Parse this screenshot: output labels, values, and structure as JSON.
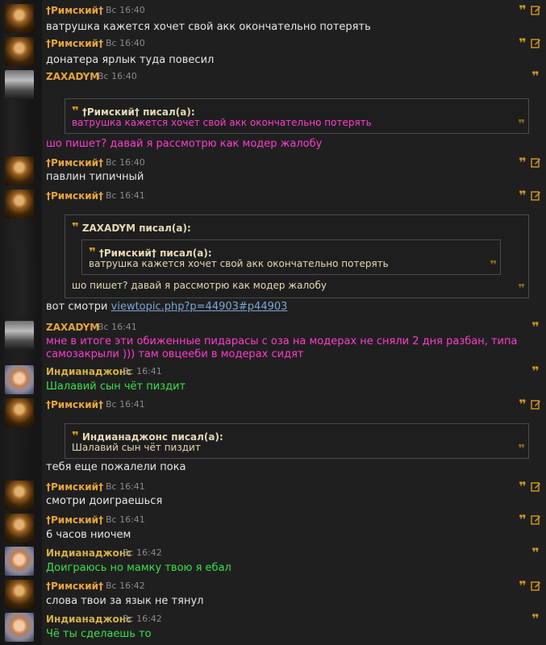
{
  "users": {
    "rimsky": "†Римский†",
    "zaxa": "ZAXADYM",
    "indy": "Индианаджонс"
  },
  "messages": [
    {
      "author": "†Римский†",
      "time": "Вс 16:40",
      "text": "ватрушка кажется хочет свой акк окончательно потерять"
    },
    {
      "author": "†Римский†",
      "time": "Вс 16:40",
      "text": "донатера ярлык туда повесил"
    },
    {
      "author": "ZAXADYM",
      "time": "Вс 16:40",
      "quote_header": "†Римский† писал(а):",
      "quote_text": "ватрушка кажется хочет свой акк окончательно потерять",
      "text": "шо пишет? давай я рассмотрю как модер жалобу"
    },
    {
      "author": "†Римский†",
      "time": "Вс 16:40",
      "text": "павлин типичный"
    },
    {
      "author": "†Римский†",
      "time": "Вс 16:41",
      "quote_header": "ZAXADYM писал(а):",
      "inner_quote_header": "†Римский† писал(а):",
      "inner_quote_text": "ватрушка кажется хочет свой акк окончательно потерять",
      "quote_text": "шо пишет? давай я рассмотрю как модер жалобу",
      "text": "вот смотри ",
      "link": "viewtopic.php?p=44903#p44903"
    },
    {
      "author": "ZAXADYM",
      "time": "Вс 16:41",
      "text_line1": "мне в итоге эти обиженные пидарасы с оза на модерах не сняли 2 дня разбан, типа",
      "text_line2": "самозакрыли ))) там овцееби в модерах сидят"
    },
    {
      "author": "Индианаджонс",
      "time": "Вс 16:41",
      "text": "Шалавий сын чёт пиздит"
    },
    {
      "author": "†Римский†",
      "time": "Вс 16:41",
      "quote_header": "Индианаджонс писал(а):",
      "quote_text": "Шалавий сын чёт пиздит",
      "text": "тебя еще пожалели пока"
    },
    {
      "author": "†Римский†",
      "time": "Вс 16:41",
      "text": "смотри доиграешься"
    },
    {
      "author": "†Римский†",
      "time": "Вс 16:41",
      "text": "6 часов ниочем"
    },
    {
      "author": "Индианаджонс",
      "time": "Вс 16:42",
      "text": "Доиграюсь но мамку твою я ебал"
    },
    {
      "author": "†Римский†",
      "time": "Вс 16:42",
      "text": "слова твои за язык не тянул"
    },
    {
      "author": "Индианаджонс",
      "time": "Вс 16:42",
      "text": "Чё ты сделаешь то"
    }
  ],
  "icons": {
    "quote": "quote-icon",
    "edit": "edit-icon"
  },
  "glyphs": {
    "quote": "❞"
  },
  "colors": {
    "author": "#e8a53a",
    "pink_text": "#ff3bd1",
    "green_text": "#3be04a",
    "link": "#7aa6d6",
    "icon": "#d89a20"
  }
}
